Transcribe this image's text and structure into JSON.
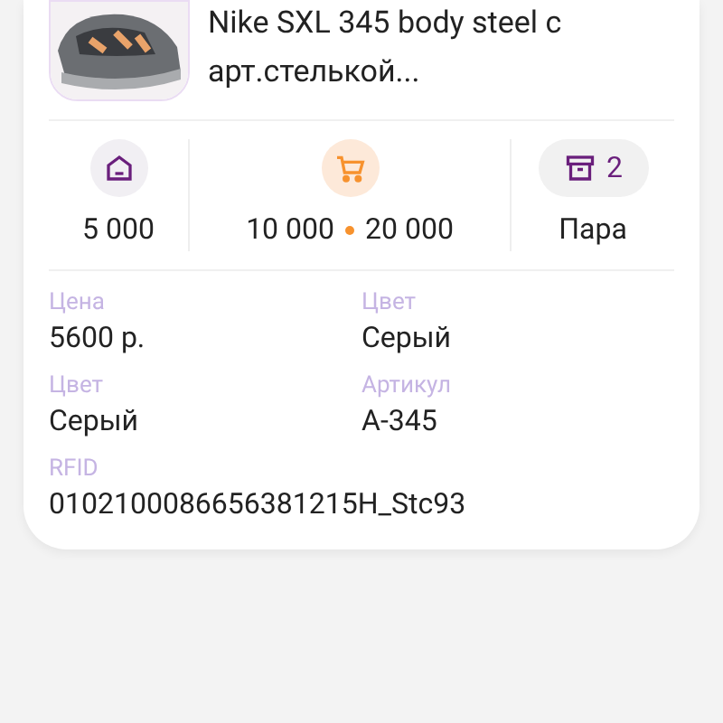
{
  "product": {
    "title": "Nike SXL 345 body steel с арт.стелькой..."
  },
  "stats": {
    "stock": "5 000",
    "range_from": "10 000",
    "range_to": "20 000",
    "pack_count": "2",
    "unit": "Пара"
  },
  "fields": [
    {
      "label": "Цена",
      "value": "5600 р."
    },
    {
      "label": "Цвет",
      "value": "Серый"
    },
    {
      "label": "Цвет",
      "value": "Серый"
    },
    {
      "label": "Артикул",
      "value": "А-345"
    },
    {
      "label": "RFID",
      "value": "0102100086656381215H_Stc93"
    }
  ]
}
